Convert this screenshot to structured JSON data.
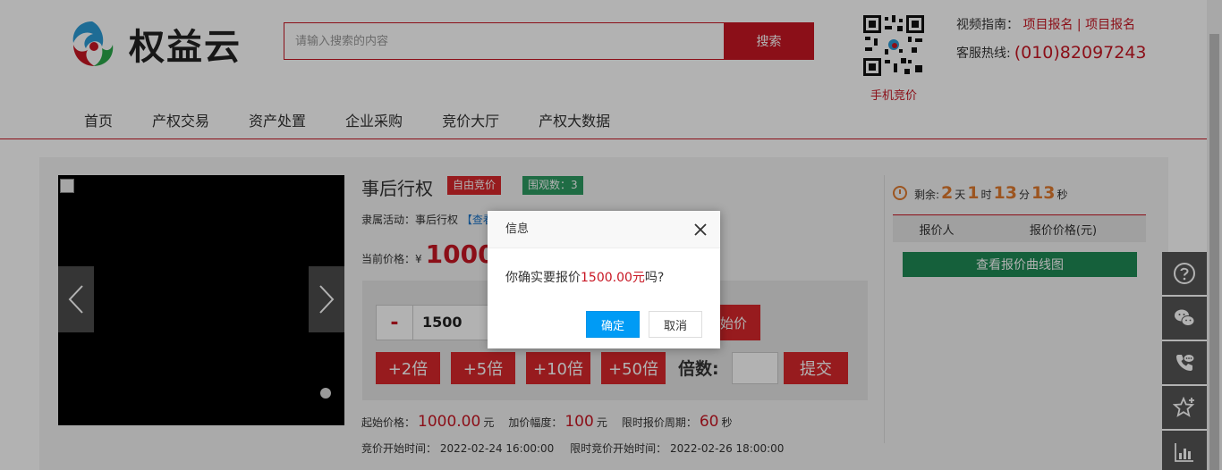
{
  "header": {
    "logo_text": "权益云",
    "search_placeholder": "请输入搜索的内容",
    "search_button": "搜索",
    "qr_caption": "手机竞价",
    "guide_label": "视频指南：",
    "guide_link1": "项目报名",
    "guide_sep": "|",
    "guide_link2": "项目报名",
    "hotline_label": "客服热线:",
    "hotline_number": "(010)82097243"
  },
  "nav": {
    "items": [
      "首页",
      "产权交易",
      "资产处置",
      "企业采购",
      "竞价大厅",
      "产权大数据"
    ]
  },
  "item": {
    "title": "事后行权",
    "badge_mode": "自由竞价",
    "badge_views": "围观数：3",
    "activity_label": "隶属活动：事后行权",
    "activity_link": "【查看",
    "current_label": "当前价格：¥",
    "current_value": "1000"
  },
  "bid": {
    "minus": "-",
    "amount": "1500",
    "start_btn": "始价",
    "mult_buttons": [
      "+2倍",
      "+5倍",
      "+10倍",
      "+50倍"
    ],
    "mult_label": "倍数:",
    "submit": "提交"
  },
  "info": {
    "start_label": "起始价格：",
    "start_value": "1000.00",
    "start_unit": "元",
    "inc_label": "加价幅度：",
    "inc_value": "100",
    "inc_unit": "元",
    "period_label": "限时报价周期：",
    "period_value": "60",
    "period_unit": "秒",
    "begin_label": "竞价开始时间：",
    "begin_value": "2022-02-24 16:00:00",
    "limit_label": "限时竞价开始时间：",
    "limit_value": "2022-02-26 18:00:00"
  },
  "countdown": {
    "label": "剩余:",
    "days": "2",
    "days_unit": "天",
    "hours": "1",
    "hours_unit": "时",
    "mins": "13",
    "mins_unit": "分",
    "secs": "13",
    "secs_unit": "秒"
  },
  "table": {
    "col1": "报价人",
    "col2": "报价价格(元)",
    "curve_btn": "查看报价曲线图"
  },
  "dialog": {
    "title": "信息",
    "msg_prefix": "你确实要报价",
    "msg_amount": "1500.00元",
    "msg_suffix": "吗?",
    "ok": "确定",
    "cancel": "取消"
  },
  "colors": {
    "brand_red": "#c81623",
    "green": "#2d9b62",
    "dialog_blue": "#009bf5"
  }
}
